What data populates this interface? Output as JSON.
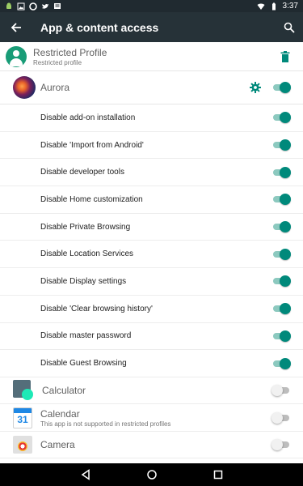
{
  "status_bar": {
    "time": "3:37",
    "left_icons": [
      "android-icon",
      "image-icon",
      "opera-icon",
      "twitter-icon",
      "message-icon"
    ],
    "right_icons": [
      "wifi-icon",
      "battery-icon"
    ]
  },
  "app_bar": {
    "title": "App & content access",
    "back_icon": "arrow-back-icon",
    "search_icon": "search-icon"
  },
  "profile": {
    "name": "Restricted Profile",
    "subtitle": "Restricted profile",
    "delete_icon": "trash-icon"
  },
  "aurora": {
    "label": "Aurora",
    "settings_icon": "gear-icon",
    "enabled": true
  },
  "restrictions": [
    {
      "label": "Disable add-on installation",
      "enabled": true
    },
    {
      "label": "Disable 'Import from Android'",
      "enabled": true
    },
    {
      "label": "Disable developer tools",
      "enabled": true
    },
    {
      "label": "Disable Home customization",
      "enabled": true
    },
    {
      "label": "Disable Private Browsing",
      "enabled": true
    },
    {
      "label": "Disable Location Services",
      "enabled": true
    },
    {
      "label": "Disable Display settings",
      "enabled": true
    },
    {
      "label": "Disable 'Clear browsing history'",
      "enabled": true
    },
    {
      "label": "Disable master password",
      "enabled": true
    },
    {
      "label": "Disable Guest Browsing",
      "enabled": true
    }
  ],
  "apps": {
    "calculator": {
      "label": "Calculator",
      "enabled": false
    },
    "calendar": {
      "label": "Calendar",
      "icon_text": "31",
      "subtitle": "This app is not supported in restricted profiles",
      "enabled": false
    },
    "camera": {
      "label": "Camera",
      "enabled": false
    }
  },
  "nav_bar": {
    "icons": [
      "back-triangle-icon",
      "home-circle-icon",
      "recents-square-icon"
    ]
  },
  "colors": {
    "accent": "#00897b",
    "accent_track": "#8cc9bf",
    "app_bar": "#263238",
    "status_bar": "#202a30",
    "avatar": "#189c77"
  }
}
